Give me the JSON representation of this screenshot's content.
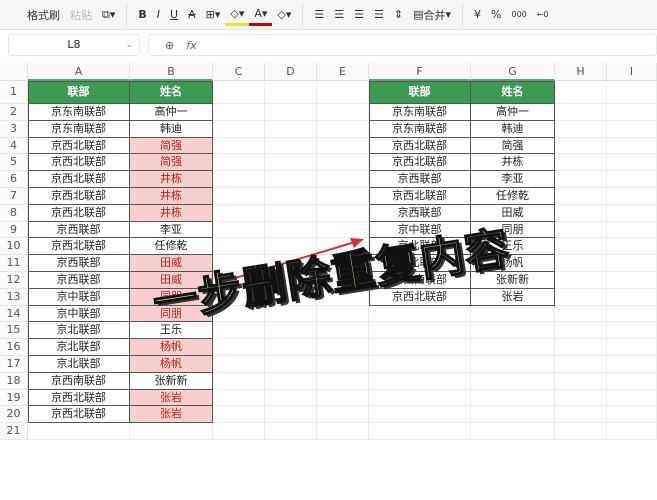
{
  "toolbar": {
    "format_painter": "格式刷",
    "paste": "粘贴",
    "bold": "B",
    "italic": "I",
    "underline": "U",
    "strike": "A",
    "merge": "合并",
    "currency": "¥",
    "percent": "%",
    "thousands": "000",
    "decimal": "←0"
  },
  "name_box": "L8",
  "formula_label": "fx",
  "columns": [
    "A",
    "B",
    "C",
    "D",
    "E",
    "F",
    "G",
    "H",
    "I"
  ],
  "row_count": 21,
  "left_table": {
    "headers": [
      "联部",
      "姓名"
    ],
    "rows": [
      [
        "京东南联部",
        "高仲一",
        false
      ],
      [
        "京东南联部",
        "韩迪",
        false
      ],
      [
        "京西北联部",
        "简强",
        true
      ],
      [
        "京西北联部",
        "简强",
        true
      ],
      [
        "京西北联部",
        "井栋",
        true
      ],
      [
        "京西北联部",
        "井栋",
        true
      ],
      [
        "京西北联部",
        "井栋",
        true
      ],
      [
        "京西联部",
        "李亚",
        false
      ],
      [
        "京西北联部",
        "任修乾",
        false
      ],
      [
        "京西联部",
        "田威",
        true
      ],
      [
        "京西联部",
        "田威",
        true
      ],
      [
        "京中联部",
        "同朋",
        true
      ],
      [
        "京中联部",
        "同朋",
        true
      ],
      [
        "京北联部",
        "王乐",
        false
      ],
      [
        "京北联部",
        "杨帆",
        true
      ],
      [
        "京北联部",
        "杨帆",
        true
      ],
      [
        "京西南联部",
        "张新新",
        false
      ],
      [
        "京西北联部",
        "张岩",
        true
      ],
      [
        "京西北联部",
        "张岩",
        true
      ]
    ]
  },
  "right_table": {
    "headers": [
      "联部",
      "姓名"
    ],
    "rows": [
      [
        "京东南联部",
        "高仲一"
      ],
      [
        "京东南联部",
        "韩迪"
      ],
      [
        "京西北联部",
        "简强"
      ],
      [
        "京西北联部",
        "井栋"
      ],
      [
        "京西联部",
        "李亚"
      ],
      [
        "京西北联部",
        "任修乾"
      ],
      [
        "京西联部",
        "田威"
      ],
      [
        "京中联部",
        "同朋"
      ],
      [
        "京北联部",
        "王乐"
      ],
      [
        "京北联部",
        "杨帆"
      ],
      [
        "京西南联部",
        "张新新"
      ],
      [
        "京西北联部",
        "张岩"
      ]
    ]
  },
  "overlay_text": "一步删除重复内容",
  "colors": {
    "header_green": "#3d9a55",
    "dup_fill": "#f8cfcf",
    "dup_text": "#b3261e",
    "arrow": "#d0352a"
  }
}
